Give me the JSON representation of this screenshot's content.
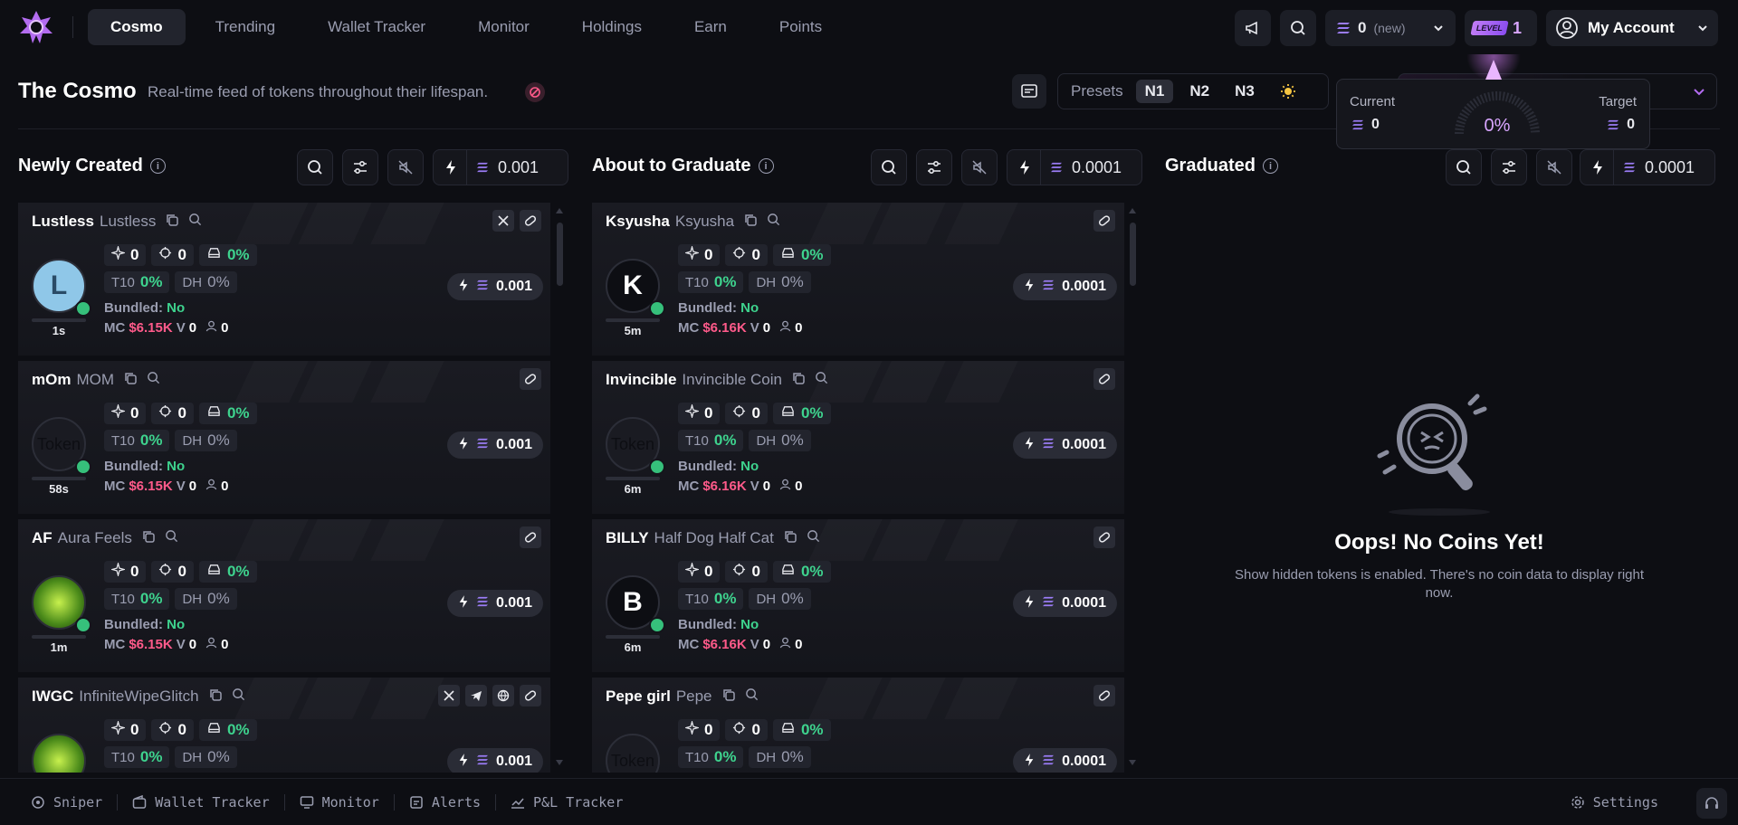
{
  "nav": {
    "items": [
      "Cosmo",
      "Trending",
      "Wallet Tracker",
      "Monitor",
      "Holdings",
      "Earn",
      "Points"
    ],
    "active": "Cosmo"
  },
  "topbar": {
    "wallet_balance": "0",
    "wallet_new": "(new)",
    "level_label": "LEVEL",
    "level": "1",
    "account_label": "My Account"
  },
  "page": {
    "title": "The Cosmo",
    "subtitle": "Real-time feed of tokens throughout their lifespan."
  },
  "presets": {
    "label": "Presets",
    "items": [
      "N1",
      "N2",
      "N3"
    ],
    "active": "N1"
  },
  "popover": {
    "current_label": "Current",
    "current_value": "0",
    "gauge_value": "0%",
    "target_label": "Target",
    "target_value": "0"
  },
  "columns": {
    "new": {
      "title": "Newly Created",
      "amount": "0.001"
    },
    "graduate": {
      "title": "About to Graduate",
      "amount": "0.0001"
    },
    "graduated": {
      "title": "Graduated",
      "amount": "0.0001"
    }
  },
  "newly_created": [
    {
      "ticker": "Lustless",
      "name": "Lustless",
      "age": "1s",
      "snipers": "0",
      "holders_pct": "0",
      "insiders": "0%",
      "t10": "0%",
      "dh": "0%",
      "bundled": "No",
      "mc": "$6.15K",
      "v": "0",
      "holders": "0",
      "buy": "0.001",
      "avatar_letter": "L",
      "links": [
        "x",
        "link"
      ]
    },
    {
      "ticker": "mOm",
      "name": "MOM",
      "age": "58s",
      "snipers": "0",
      "holders_pct": "0",
      "insiders": "0%",
      "t10": "0%",
      "dh": "0%",
      "bundled": "No",
      "mc": "$6.15K",
      "v": "0",
      "holders": "0",
      "buy": "0.001",
      "avatar_letter": "Token",
      "links": [
        "link"
      ]
    },
    {
      "ticker": "AF",
      "name": "Aura Feels",
      "age": "1m",
      "snipers": "0",
      "holders_pct": "0",
      "insiders": "0%",
      "t10": "0%",
      "dh": "0%",
      "bundled": "No",
      "mc": "$6.15K",
      "v": "0",
      "holders": "0",
      "buy": "0.001",
      "avatar_letter": "",
      "links": [
        "link"
      ]
    },
    {
      "ticker": "IWGC",
      "name": "InfiniteWipeGlitch",
      "age": "",
      "snipers": "0",
      "holders_pct": "0",
      "insiders": "0%",
      "t10": "0%",
      "dh": "0%",
      "bundled": "",
      "mc": "",
      "v": "",
      "holders": "",
      "buy": "0.001",
      "avatar_letter": "",
      "links": [
        "x",
        "telegram",
        "web",
        "link"
      ]
    }
  ],
  "about_to_graduate": [
    {
      "ticker": "Ksyusha",
      "name": "Ksyusha",
      "age": "5m",
      "snipers": "0",
      "holders_pct": "0",
      "insiders": "0%",
      "t10": "0%",
      "dh": "0%",
      "bundled": "No",
      "mc": "$6.16K",
      "v": "0",
      "holders": "0",
      "buy": "0.0001",
      "avatar_letter": "K"
    },
    {
      "ticker": "Invincible",
      "name": "Invincible Coin",
      "age": "6m",
      "snipers": "0",
      "holders_pct": "0",
      "insiders": "0%",
      "t10": "0%",
      "dh": "0%",
      "bundled": "No",
      "mc": "$6.16K",
      "v": "0",
      "holders": "0",
      "buy": "0.0001",
      "avatar_letter": "Token"
    },
    {
      "ticker": "BILLY",
      "name": "Half Dog Half Cat",
      "age": "6m",
      "snipers": "0",
      "holders_pct": "0",
      "insiders": "0%",
      "t10": "0%",
      "dh": "0%",
      "bundled": "No",
      "mc": "$6.16K",
      "v": "0",
      "holders": "0",
      "buy": "0.0001",
      "avatar_letter": "B"
    },
    {
      "ticker": "Pepe girl",
      "name": "Pepe",
      "age": "",
      "snipers": "0",
      "holders_pct": "0",
      "insiders": "0%",
      "t10": "0%",
      "dh": "0%",
      "bundled": "",
      "mc": "",
      "v": "",
      "holders": "",
      "buy": "0.0001",
      "avatar_letter": "Token"
    }
  ],
  "labels": {
    "t10": "T10",
    "dh": "DH",
    "bundled": "Bundled:",
    "mc": "MC",
    "v": "V"
  },
  "empty": {
    "title": "Oops! No Coins Yet!",
    "text": "Show hidden tokens is enabled. There's no coin data to display right now."
  },
  "bottom": {
    "items": [
      "Sniper",
      "Wallet Tracker",
      "Monitor",
      "Alerts",
      "P&L Tracker"
    ],
    "settings": "Settings"
  },
  "colors": {
    "accent": "#d9a6ff",
    "green": "#3ed38e",
    "pink": "#ff5a8a",
    "background": "#0d0e13"
  }
}
